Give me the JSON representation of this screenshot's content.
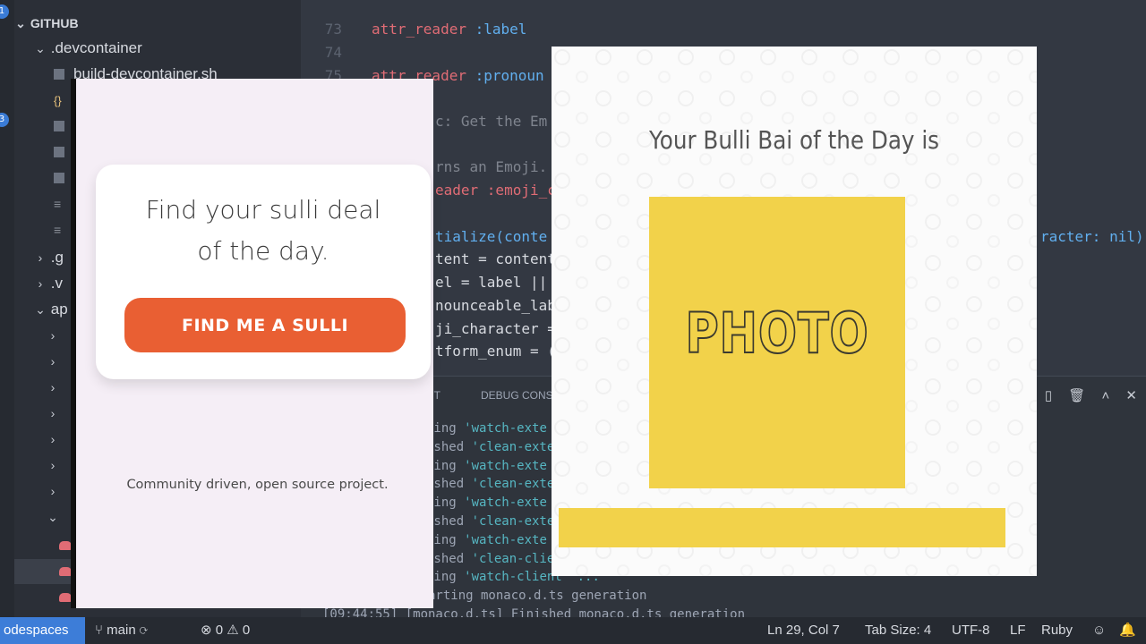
{
  "sidebar": {
    "badges": [
      "1",
      "3"
    ],
    "rows": [
      {
        "chevron": "⌄",
        "label": "GITHUB",
        "indent": 0,
        "kind": "section"
      },
      {
        "chevron": "⌄",
        "label": ".devcontainer",
        "indent": 1,
        "kind": "folder"
      },
      {
        "chevron": "",
        "label": "build-devcontainer.sh",
        "indent": 2,
        "kind": "file"
      },
      {
        "chevron": "",
        "label": "",
        "indent": 2,
        "kind": "json"
      },
      {
        "chevron": "",
        "label": "",
        "indent": 2,
        "kind": "file"
      },
      {
        "chevron": "",
        "label": "",
        "indent": 2,
        "kind": "file"
      },
      {
        "chevron": "",
        "label": "",
        "indent": 2,
        "kind": "file"
      },
      {
        "chevron": "",
        "label": "",
        "indent": 2,
        "kind": "lines"
      },
      {
        "chevron": "",
        "label": "",
        "indent": 2,
        "kind": "lines"
      },
      {
        "chevron": "›",
        "label": ".g",
        "indent": 1,
        "kind": "folder"
      },
      {
        "chevron": "›",
        "label": ".v",
        "indent": 1,
        "kind": "folder"
      },
      {
        "chevron": "⌄",
        "label": "ap",
        "indent": 1,
        "kind": "folder"
      }
    ]
  },
  "editor": {
    "lines": [
      {
        "num": "73",
        "kw": "attr_reader",
        "rest": " :label"
      },
      {
        "num": "74",
        "kw": "",
        "rest": ""
      },
      {
        "num": "75",
        "kw": "attr_reader",
        "rest": " :pronoun"
      }
    ],
    "fragments": [
      "c: Get the Em",
      "rns an Emoji.",
      "eader :emoji_c",
      "tialize(conte",
      "tent = content",
      "el = label ||",
      "nounceable_lab",
      "ji_character =",
      "tform_enum = (",
      "racter: nil)"
    ]
  },
  "panel": {
    "tabs": [
      "UT",
      "DEBUG CONS"
    ],
    "terminal": [
      {
        "a": "ting ",
        "b": "'watch-exte"
      },
      {
        "a": "ished ",
        "b": "'clean-exte"
      },
      {
        "a": "ting ",
        "b": "'watch-exte"
      },
      {
        "a": "ished ",
        "b": "'clean-exte"
      },
      {
        "a": "ting ",
        "b": "'watch-exte"
      },
      {
        "a": "ished ",
        "b": "'clean-exte"
      },
      {
        "a": "ting ",
        "b": "'watch-exte"
      },
      {
        "a": "ished ",
        "b": "'clean-clie"
      },
      {
        "a": "ting ",
        "b": "'watch-client' ..."
      }
    ],
    "log1": "onaco.d.ts] Starting monaco.d.ts generation",
    "log2": "[09:44:55] [monaco.d.ts] Finished monaco.d.ts generation"
  },
  "statusbar": {
    "remote": "odespaces",
    "branch": "main",
    "errors": "0",
    "warnings": "0",
    "position": "Ln 29, Col 7",
    "tab_size": "Tab Size: 4",
    "encoding": "UTF-8",
    "eol": "LF",
    "language": "Ruby"
  },
  "left_card": {
    "title_line1": "Find your sulli deal",
    "title_line2": "of the day.",
    "button": "FIND ME A SULLI",
    "footer": "Community driven, open source project."
  },
  "right_card": {
    "title": "Your Bulli Bai of the Day is",
    "photo": "PHOTO",
    "photo_color": "#f2d24a"
  }
}
